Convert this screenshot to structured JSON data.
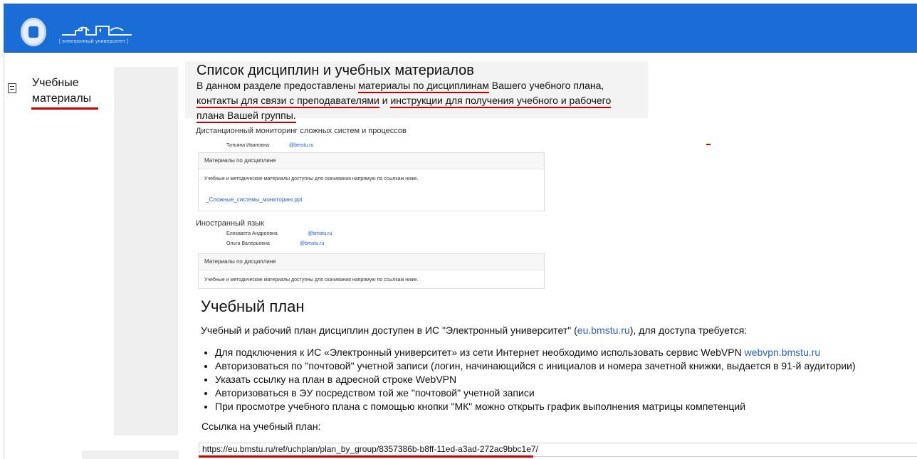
{
  "header": {
    "brand_subtitle": "[ электронный университет ]"
  },
  "sidebar": {
    "item_label": "Учебные\nматериалы"
  },
  "main": {
    "title": "Список дисциплин и учебных материалов",
    "intro": {
      "part1": "В данном разделе предоставлены ",
      "part2": "материалы по дисциплинам",
      "part3": " Вашего учебного плана, ",
      "part4": "контакты для связи с преподавателями",
      "part5": " и ",
      "part6": "инструкции для получения учебного и рабочего плана Вашей группы.",
      "part7": ""
    },
    "course1": {
      "title": "Дистанционный мониторинг сложных систем и процессов",
      "teacher_name": "Татьяна Ивановна",
      "teacher_email": "@bmstu.ru",
      "box_title": "Материалы по дисциплине",
      "box_text": "Учебные и методические материалы доступны для скачивания напрямую по ссылкам ниже.",
      "file_link": "_Сложные_системы_мониторинг.ppt"
    },
    "course2": {
      "title": "Иностранный язык",
      "teacher1_name": "Елизавета Андреевна",
      "teacher1_email": "@bmstu.ru",
      "teacher2_name": "Ольга Валерьевна",
      "teacher2_email": "@bmstu.ru",
      "box_title": "Материалы по дисциплине",
      "box_text": "Учебные и методические материалы доступны для скачивания напрямую по ссылкам ниже."
    },
    "plan": {
      "title": "Учебный план",
      "text_part1": "Учебный и рабочий план дисциплин доступен в ИС \"Электронный университет\" (",
      "text_link": "eu.bmstu.ru",
      "text_part2": "), для доступа требуется:",
      "bullets": [
        "Для подключения к ИС «Электронный университет» из сети Интернет необходимо использовать сервис WebVPN ",
        "Авторизоваться по \"почтовой\" учетной записи (логин, начинающийся с инициалов и номера зачетной книжки, выдается в 91-й аудитории)",
        "Указать ссылку на план в адресной строке WebVPN",
        "Авторизоваться в ЭУ посредством той же \"почтовой\" учетной записи",
        "При просмотре учебного плана с помощью кнопки \"МК\" можно открыть график выполнения матрицы компетенций"
      ],
      "bullet1_link": "webvpn.bmstu.ru",
      "link_label": "Ссылка на учебный план:",
      "url": "https://eu.bmstu.ru/ref/uchplan/plan_by_group/8357386b-b8ff-11ed-a3ad-272ac9bbc1e7/"
    }
  }
}
